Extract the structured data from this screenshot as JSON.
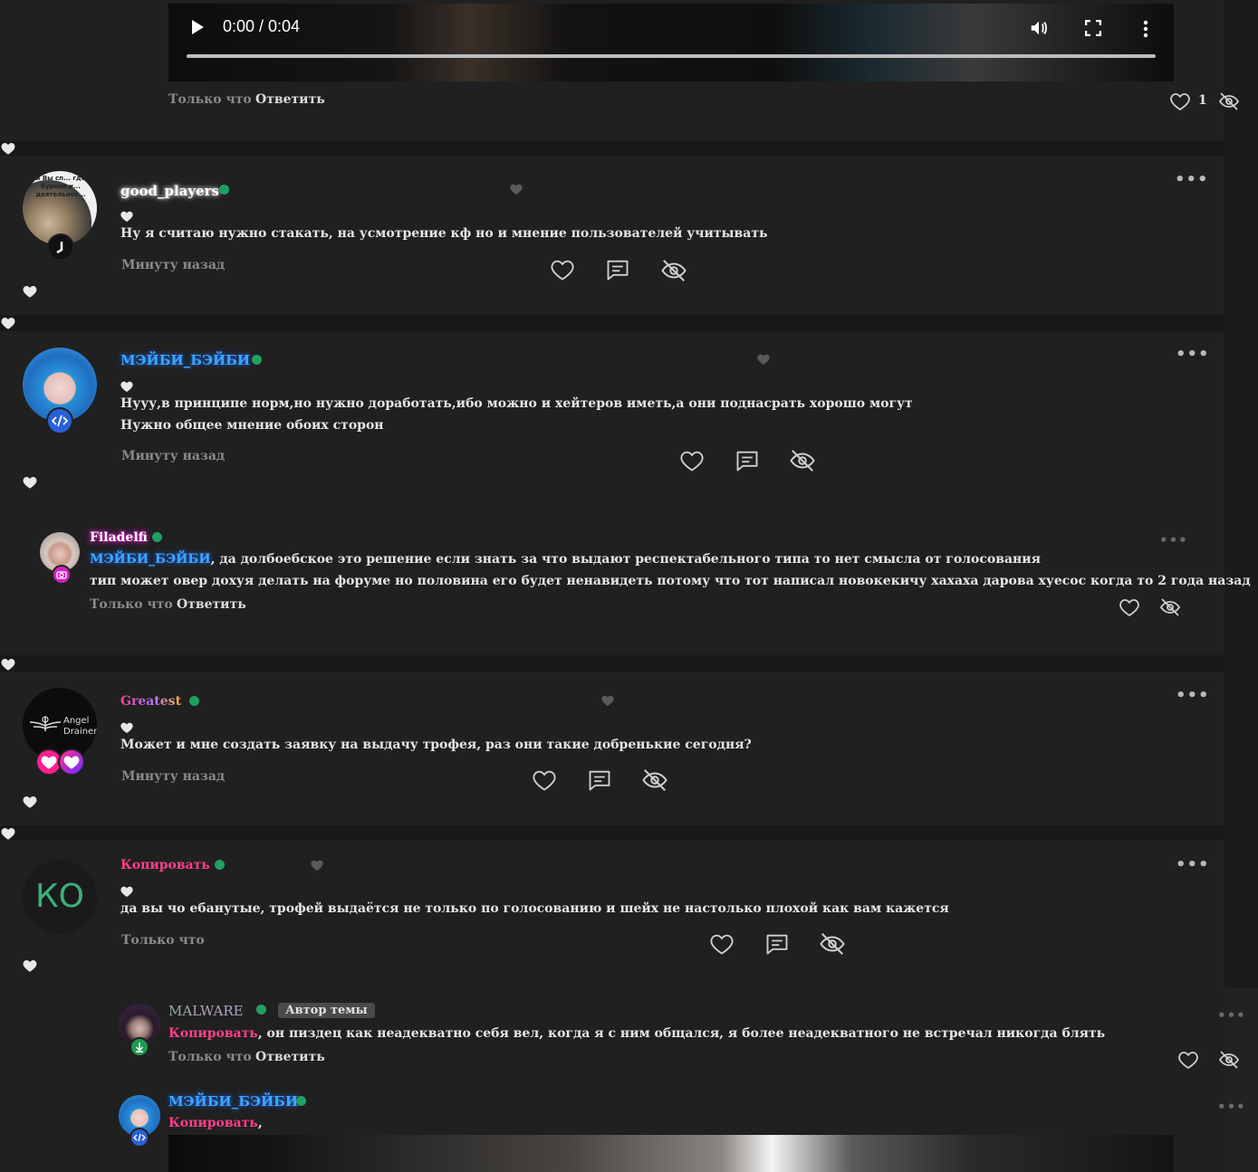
{
  "video_top": {
    "time": "0:00 / 0:04"
  },
  "top_reply": {
    "time": "Только что",
    "reply_label": "Ответить",
    "likes": "1"
  },
  "comments": [
    {
      "username": "good_players",
      "avatar_caption": "и Вы сп... где бурная и... деятельнос...",
      "text": "Ну я считаю нужно стакать, на усмотрение кф но и мнение пользователей учитывать",
      "time": "Минуту назад"
    },
    {
      "username": "МЭЙБИ_БЭЙБИ",
      "text_line1": "Нууу,в принципе норм,но нужно доработать,ибо можно и хейтеров иметь,а они поднасрать хорошо могут",
      "text_line2": "Нужно общее мнение обоих сторон",
      "time": "Минуту назад",
      "reply": {
        "username": "Filadelfi",
        "mention": "МЭЙБИ_БЭЙБИ",
        "text_line1_rest": ", да долбоебское это решение если знать за что выдают респектабельного типа то нет смысла от голосования",
        "text_line2": "тип может овер дохуя делать на форуме но половина его будет ненавидеть потому что тот написал новокекичу хахаха дарова хуесос когда то 2 года назад",
        "time": "Только что",
        "reply_label": "Ответить"
      }
    },
    {
      "username": "Greatest",
      "avatar_caption_1": "Angel",
      "avatar_caption_2": "Drainer",
      "text": "Может и мне создать заявку на выдачу трофея, раз они такие добренькие сегодня?",
      "time": "Минуту назад"
    },
    {
      "username": "Копировать",
      "avatar_initials": "КО",
      "text": "да вы чо ебанутые, трофей выдаётся не только по голосованию и шейх не настолько плохой как вам кажется",
      "time": "Только что",
      "replies": [
        {
          "username": "MALWARE",
          "tag": "Автор темы",
          "mention": "Копировать",
          "text_rest": ", он пиздец как неадекватно себя вел, когда я с ним общался, я более неадекватного не встречал никогда блять",
          "time": "Только что",
          "reply_label": "Ответить"
        },
        {
          "username": "МЭЙБИ_БЭЙБИ",
          "mention": "Копировать",
          "text_rest": ","
        }
      ]
    }
  ],
  "colors": {
    "background": "#1b1b1b",
    "panel": "#202020",
    "online": "#20a060",
    "mention_blue": "#3ca6ff",
    "mention_pink": "#ff3f8e"
  }
}
